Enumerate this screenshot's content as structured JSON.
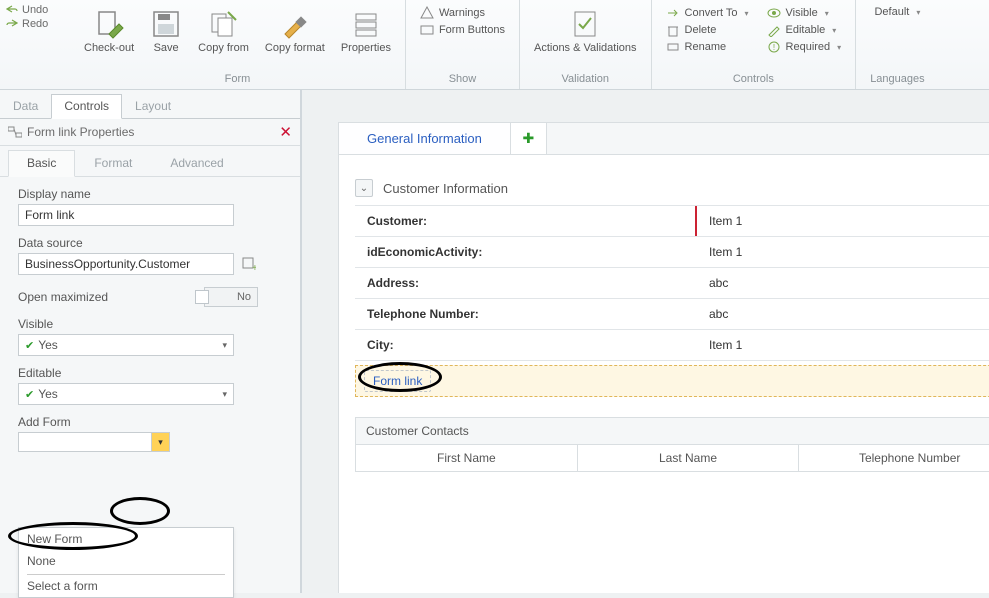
{
  "qat": {
    "undo": "Undo",
    "redo": "Redo"
  },
  "ribbon": {
    "form": {
      "label": "Form",
      "checkout": "Check-out",
      "save": "Save",
      "copyfrom": "Copy from",
      "copyformat": "Copy format",
      "properties": "Properties"
    },
    "show": {
      "label": "Show",
      "warnings": "Warnings",
      "formbuttons": "Form Buttons"
    },
    "validation": {
      "label": "Validation",
      "actions": "Actions & Validations"
    },
    "controls": {
      "label": "Controls",
      "convert": "Convert To",
      "delete": "Delete",
      "rename": "Rename",
      "visible": "Visible",
      "editable": "Editable",
      "required": "Required"
    },
    "languages": {
      "label": "Languages",
      "default": "Default"
    }
  },
  "left_tabs": {
    "data": "Data",
    "controls": "Controls",
    "layout": "Layout"
  },
  "prop_header": "Form link Properties",
  "prop_tabs": {
    "basic": "Basic",
    "format": "Format",
    "advanced": "Advanced"
  },
  "props": {
    "display_name_label": "Display name",
    "display_name_value": "Form link",
    "data_source_label": "Data source",
    "data_source_value": "BusinessOpportunity.Customer",
    "open_max_label": "Open maximized",
    "open_max_value": "No",
    "visible_label": "Visible",
    "visible_value": "Yes",
    "editable_label": "Editable",
    "editable_value": "Yes",
    "add_form_label": "Add Form"
  },
  "dropdown": {
    "new_form": "New Form",
    "none": "None",
    "select": "Select a form"
  },
  "canvas": {
    "tab_title": "General Information",
    "section_title": "Customer Information",
    "rows": [
      {
        "label": "Customer:",
        "value": "Item 1",
        "required": true
      },
      {
        "label": "idEconomicActivity:",
        "value": "Item 1",
        "required": false
      },
      {
        "label": "Address:",
        "value": "abc",
        "required": false
      },
      {
        "label": "Telephone Number:",
        "value": "abc",
        "required": false
      },
      {
        "label": "City:",
        "value": "Item 1",
        "required": false
      }
    ],
    "link_text": "Form link",
    "grid_title": "Customer Contacts",
    "grid_cols": [
      "First Name",
      "Last Name",
      "Telephone Number"
    ]
  }
}
